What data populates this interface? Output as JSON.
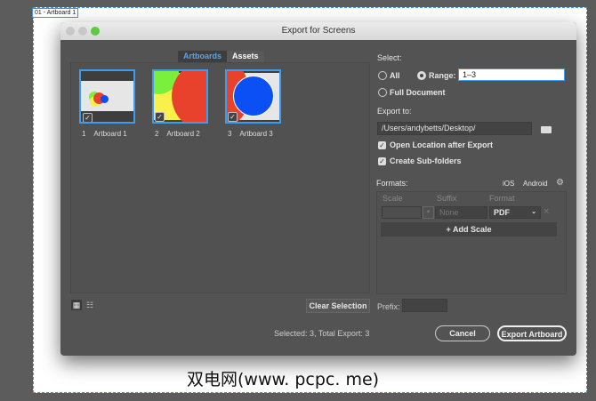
{
  "artboard_label": "01 - Artboard 1",
  "dialog": {
    "title": "Export for Screens",
    "tabs": [
      {
        "label": "Artboards",
        "active": true
      },
      {
        "label": "Assets",
        "active": false
      }
    ],
    "artboards": [
      {
        "num": "1",
        "name": "Artboard 1",
        "checked": true
      },
      {
        "num": "2",
        "name": "Artboard 2",
        "checked": true
      },
      {
        "num": "3",
        "name": "Artboard 3",
        "checked": true
      }
    ],
    "select_label": "Select:",
    "all_label": "All",
    "range_label": "Range:",
    "range_value": "1–3",
    "full_doc_label": "Full Document",
    "export_to_label": "Export to:",
    "path_value": "/Users/andybetts/Desktop/",
    "open_location_label": "Open Location after Export",
    "sub_folders_label": "Create Sub-folders",
    "formats_label": "Formats:",
    "ios_label": "iOS",
    "android_label": "Android",
    "col_scale": "Scale",
    "col_suffix": "Suffix",
    "col_format": "Format",
    "suffix_placeholder": "None",
    "format_value": "PDF",
    "add_scale_label": "+ Add Scale",
    "clear_selection_label": "Clear Selection",
    "prefix_label": "Prefix:",
    "status": "Selected: 3, Total Export: 3",
    "cancel_label": "Cancel",
    "export_label": "Export Artboard"
  },
  "watermark": "双电网(www. pcpc. me)",
  "colors": {
    "accent": "#3d9bf0",
    "red": "#e8412c",
    "green": "#7af03c",
    "yellow": "#faf04a",
    "blue": "#0a50f5"
  }
}
